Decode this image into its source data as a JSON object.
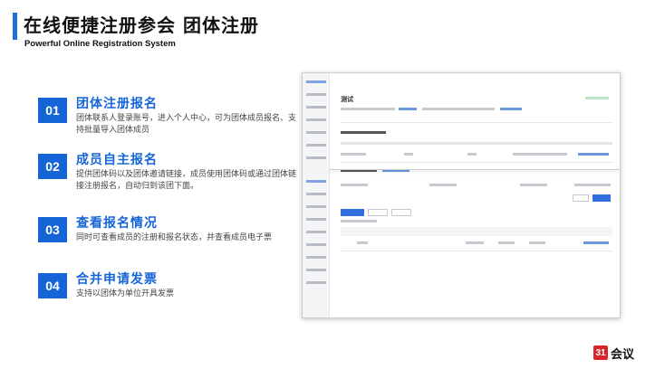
{
  "header": {
    "title": "在线便捷注册参会 团体注册",
    "subtitle": "Powerful Online Registration System"
  },
  "features": [
    {
      "num": "01",
      "title": "团体注册报名",
      "desc": "团体联系人登录账号，进入个人中心，可为团体成员报名、支持批量导入团体成员"
    },
    {
      "num": "02",
      "title": "成员自主报名",
      "desc": "提供团体码以及团体邀请链接，成员使用团体码或通过团体链接注册报名，自动归到该团下面。"
    },
    {
      "num": "03",
      "title": "查看报名情况",
      "desc": "同时可查看成员的注册和报名状态，并查看成员电子票"
    },
    {
      "num": "04",
      "title": "合并申请发票",
      "desc": "支持以团体为单位开具发票"
    }
  ],
  "screenshot": {
    "panel_title": "测试"
  },
  "brand": {
    "logo_mark": "31",
    "logo_text": "会议",
    "accent": "#1565d8",
    "logo_color": "#d8262a"
  }
}
